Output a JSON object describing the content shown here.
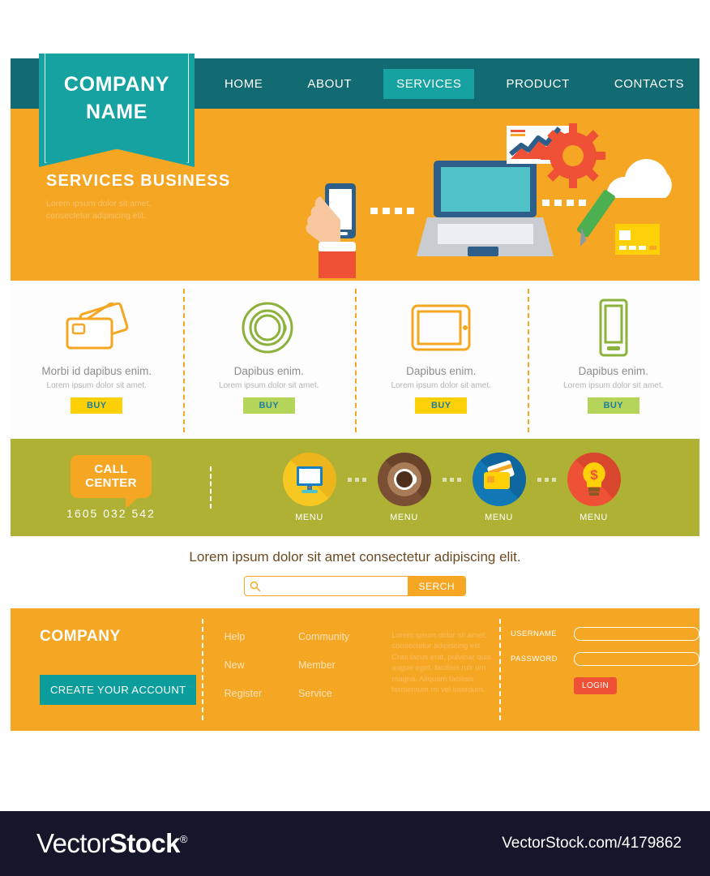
{
  "nav": {
    "items": [
      {
        "label": "HOME",
        "active": false
      },
      {
        "label": "ABOUT",
        "active": false
      },
      {
        "label": "SERVICES",
        "active": true
      },
      {
        "label": "PRODUCT",
        "active": false
      },
      {
        "label": "CONTACTS",
        "active": false
      }
    ]
  },
  "ribbon": {
    "line1": "COMPANY",
    "line2": "NAME"
  },
  "hero": {
    "title": "SERVICES  BUSINESS",
    "subtitle": "Lorem ipsum dolor sit amet,\nconsectetur adipiscing elit."
  },
  "cards": [
    {
      "icon": "credit-cards-icon",
      "title": "Morbi id dapibus enim.",
      "subtitle": "Lorem ipsum dolor sit amet.",
      "buy_label": "BUY",
      "buy_color": "#fdd007",
      "icon_color": "#f5a623"
    },
    {
      "icon": "coffee-cup-icon",
      "title": "Dapibus enim.",
      "subtitle": "Lorem ipsum dolor sit amet.",
      "buy_label": "BUY",
      "buy_color": "#b4d45a",
      "icon_color": "#8cb23c"
    },
    {
      "icon": "tablet-icon",
      "title": "Dapibus enim.",
      "subtitle": "Lorem ipsum dolor sit amet.",
      "buy_label": "BUY",
      "buy_color": "#fdd007",
      "icon_color": "#f5a623"
    },
    {
      "icon": "smartphone-icon",
      "title": "Dapibus enim.",
      "subtitle": "Lorem ipsum dolor sit amet.",
      "buy_label": "BUY",
      "buy_color": "#b4d45a",
      "icon_color": "#8cb23c"
    }
  ],
  "callcenter": {
    "bubble_line1": "CALL",
    "bubble_line2": "CENTER",
    "phone": "1605  032  542"
  },
  "menus": [
    {
      "icon": "desktop-monitor-icon",
      "label": "MENU",
      "color": "#f8c822"
    },
    {
      "icon": "coffee-cup-icon",
      "label": "MENU",
      "color": "#7b4f33"
    },
    {
      "icon": "credit-cards-icon",
      "label": "MENU",
      "color": "#1277b5"
    },
    {
      "icon": "lightbulb-dollar-icon",
      "label": "MENU",
      "color": "#ef5136"
    }
  ],
  "search": {
    "tagline": "Lorem ipsum dolor sit amet consectetur adipiscing elit.",
    "placeholder": "",
    "value": "",
    "button_label": "SERCH"
  },
  "footer": {
    "brand": "COMPANY",
    "cta_label": "CREATE YOUR ACCOUNT",
    "links": [
      "Help",
      "Community",
      "New",
      "Member",
      "Register",
      "Service"
    ],
    "text": "Lorem ipsum dolor sit amet, consectetur adipiscing elit. Cras lacus erat, pulvinar quis augue eget, facilisis rutr um magna. Aliquam facilisis fermentum mi vel interdum.",
    "username_label": "USERNAME",
    "password_label": "PASSWORD",
    "username_value": "",
    "password_value": "",
    "login_label": "LOGIN"
  },
  "watermark": {
    "logo_prefix": "Vector",
    "logo_suffix": "Stock",
    "registered": "®",
    "url": "VectorStock.com/4179862"
  },
  "colors": {
    "nav_bg": "#126b72",
    "nav_active": "#17a2a2",
    "hero_bg": "#f5a623",
    "band_bg": "#aeb134",
    "footer_bg": "#f5a623",
    "cta": "#0b9c9c",
    "login": "#ef5136"
  }
}
